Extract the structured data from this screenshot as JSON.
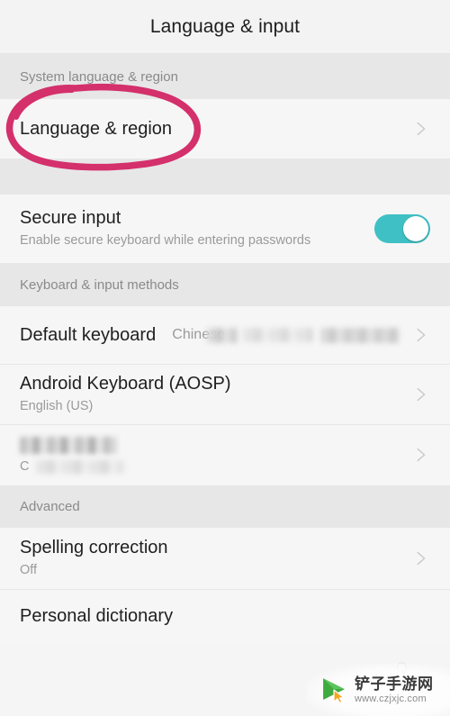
{
  "header": {
    "title": "Language & input"
  },
  "sections": [
    {
      "id": "system-language-region",
      "label": "System language & region",
      "rows": [
        {
          "id": "language-region",
          "title": "Language & region",
          "sub": "",
          "value": "",
          "accessory": "chevron-right-icon",
          "annotated": true
        }
      ]
    },
    {
      "id": "secure-input-group",
      "label": "",
      "rows": [
        {
          "id": "secure-input",
          "title": "Secure input",
          "sub": "Enable secure keyboard while entering passwords",
          "value": "",
          "accessory": "toggle-switch",
          "toggle_on": true
        }
      ]
    },
    {
      "id": "keyboard-input-methods",
      "label": "Keyboard & input methods",
      "rows": [
        {
          "id": "default-keyboard",
          "title": "Default keyboard",
          "sub": "",
          "value": "Chinese",
          "value_redacted": true,
          "accessory": "chevron-right-icon"
        },
        {
          "id": "android-keyboard-aosp",
          "title": "Android Keyboard (AOSP)",
          "sub": "English (US)",
          "value": "",
          "accessory": "chevron-right-icon"
        },
        {
          "id": "redacted-keyboard",
          "title": "",
          "title_redacted": true,
          "sub": "C",
          "sub_redacted": true,
          "value": "",
          "accessory": "chevron-right-icon"
        }
      ]
    },
    {
      "id": "advanced",
      "label": "Advanced",
      "rows": [
        {
          "id": "spelling-correction",
          "title": "Spelling correction",
          "sub": "Off",
          "value": "",
          "accessory": "chevron-right-icon"
        },
        {
          "id": "personal-dictionary",
          "title": "Personal dictionary",
          "sub": "",
          "value": "",
          "accessory": "chevron-right-icon"
        }
      ]
    }
  ],
  "annotation": {
    "shape": "hand-drawn-circle",
    "target": "Language & region",
    "color": "#d4306b"
  },
  "watermark": {
    "brand_cn": "铲子手游网",
    "url": "www.czjxjc.com",
    "logo": "green-play-cursor-icon"
  },
  "colors": {
    "toggle_on": "#3fc0c4",
    "annotation_pink": "#d4306b",
    "row_background": "#f6f6f6",
    "band_background": "#e7e7e7",
    "title_background": "#f3f3f3",
    "primary_text": "#1f1f1f",
    "secondary_text": "#9a9a9a"
  }
}
